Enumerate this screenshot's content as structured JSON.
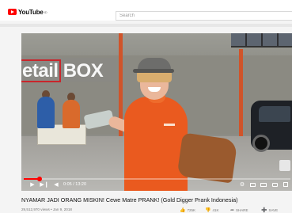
{
  "header": {
    "logo_text": "YouTube",
    "logo_sup": "ID",
    "search_placeholder": "Search"
  },
  "video": {
    "sign_text": "etail BOX",
    "current_time": "0:05",
    "duration": "13:20",
    "time_display": "0:05 / 13:20",
    "progress_fraction": 0.06,
    "controls": {
      "play_icon": "play-icon",
      "next_icon": "skip-next-icon",
      "volume_icon": "volume-icon",
      "settings_icon": "gear-icon",
      "miniplayer_icon": "miniplayer-icon",
      "theater_icon": "theater-icon",
      "cast_icon": "cast-icon",
      "fullscreen_icon": "fullscreen-icon"
    }
  },
  "info": {
    "title": "NYAMAR JADI ORANG MISKIN! Cewe Matre PRANK! (Gold Digger Prank Indonesia)",
    "meta": "29,512,970 views • Jan 9, 2018",
    "actions": [
      {
        "icon": "thumbs-up-icon",
        "label": "725K"
      },
      {
        "icon": "thumbs-down-icon",
        "label": "41K"
      },
      {
        "icon": "share-icon",
        "label": "SHARE"
      },
      {
        "icon": "save-icon",
        "label": "SAVE"
      }
    ]
  },
  "colors": {
    "brand_red": "#ff0000",
    "shirt_orange": "#ea5a1f",
    "sign_red": "#c9252b"
  }
}
